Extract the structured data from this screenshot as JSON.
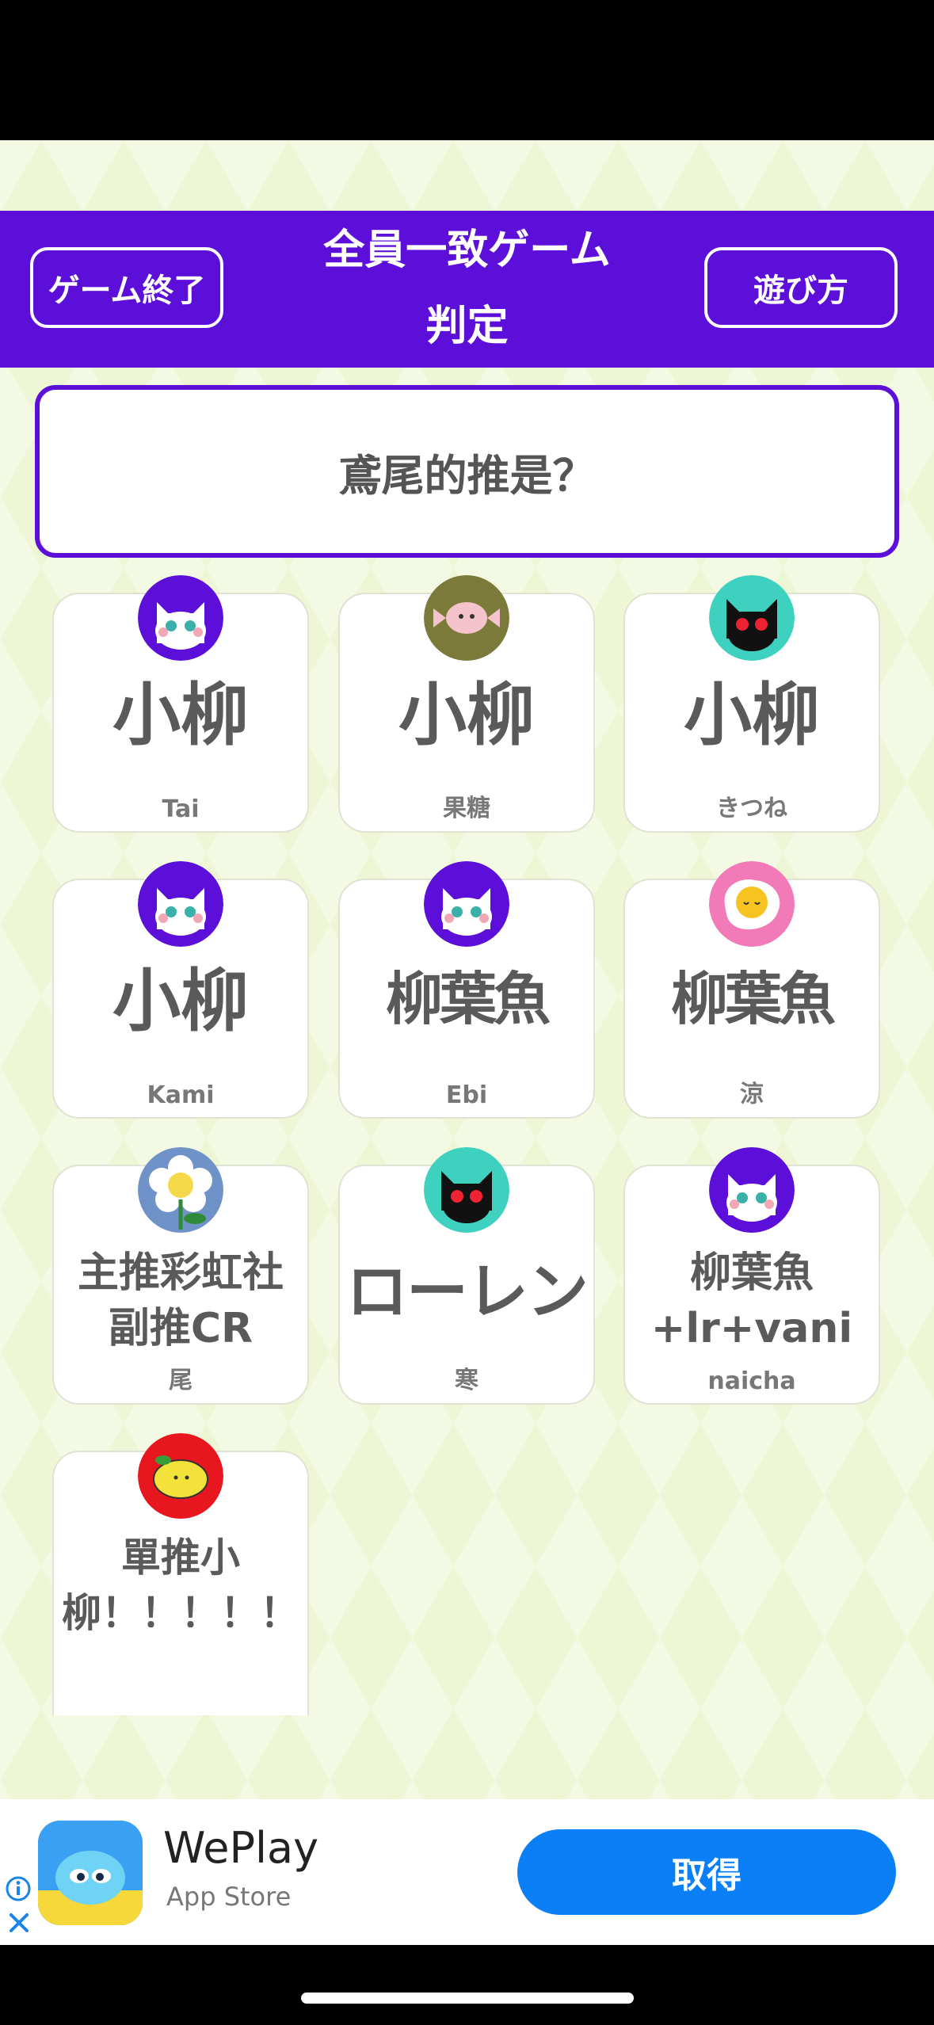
{
  "header": {
    "end_button": "ゲーム終了",
    "title_line1": "全員一致ゲーム",
    "title_line2": "判定",
    "howto_button": "遊び方"
  },
  "question": "鳶尾的推是？",
  "answers": [
    {
      "answer": "小柳",
      "player": "Tai",
      "avatar": "white-cat-icon"
    },
    {
      "answer": "小柳",
      "player": "果糖",
      "avatar": "candy-icon"
    },
    {
      "answer": "小柳",
      "player": "きつね",
      "avatar": "black-cat-icon"
    },
    {
      "answer": "小柳",
      "player": "Kami",
      "avatar": "white-cat-icon"
    },
    {
      "answer": "柳葉魚",
      "player": "Ebi",
      "avatar": "white-cat-icon"
    },
    {
      "answer": "柳葉魚",
      "player": "涼",
      "avatar": "fried-egg-icon"
    },
    {
      "answer_line1": "主推彩虹社",
      "answer_line2": "副推CR",
      "player": "尾",
      "avatar": "flower-icon"
    },
    {
      "answer": "ローレン",
      "player": "寒",
      "avatar": "black-cat-icon"
    },
    {
      "answer_line1": "柳葉魚",
      "answer_line2": "+lr+vani",
      "player": "naicha",
      "avatar": "white-cat-icon"
    },
    {
      "answer_line1": "單推小",
      "answer_line2": "柳！！！！！",
      "avatar": "lemon-icon"
    }
  ],
  "ad": {
    "app_name": "WePlay",
    "store": "App Store",
    "get_button": "取得"
  },
  "colors": {
    "header": "#5b0fd9",
    "background": "#eef6d6",
    "get_button": "#0a7ff6"
  }
}
